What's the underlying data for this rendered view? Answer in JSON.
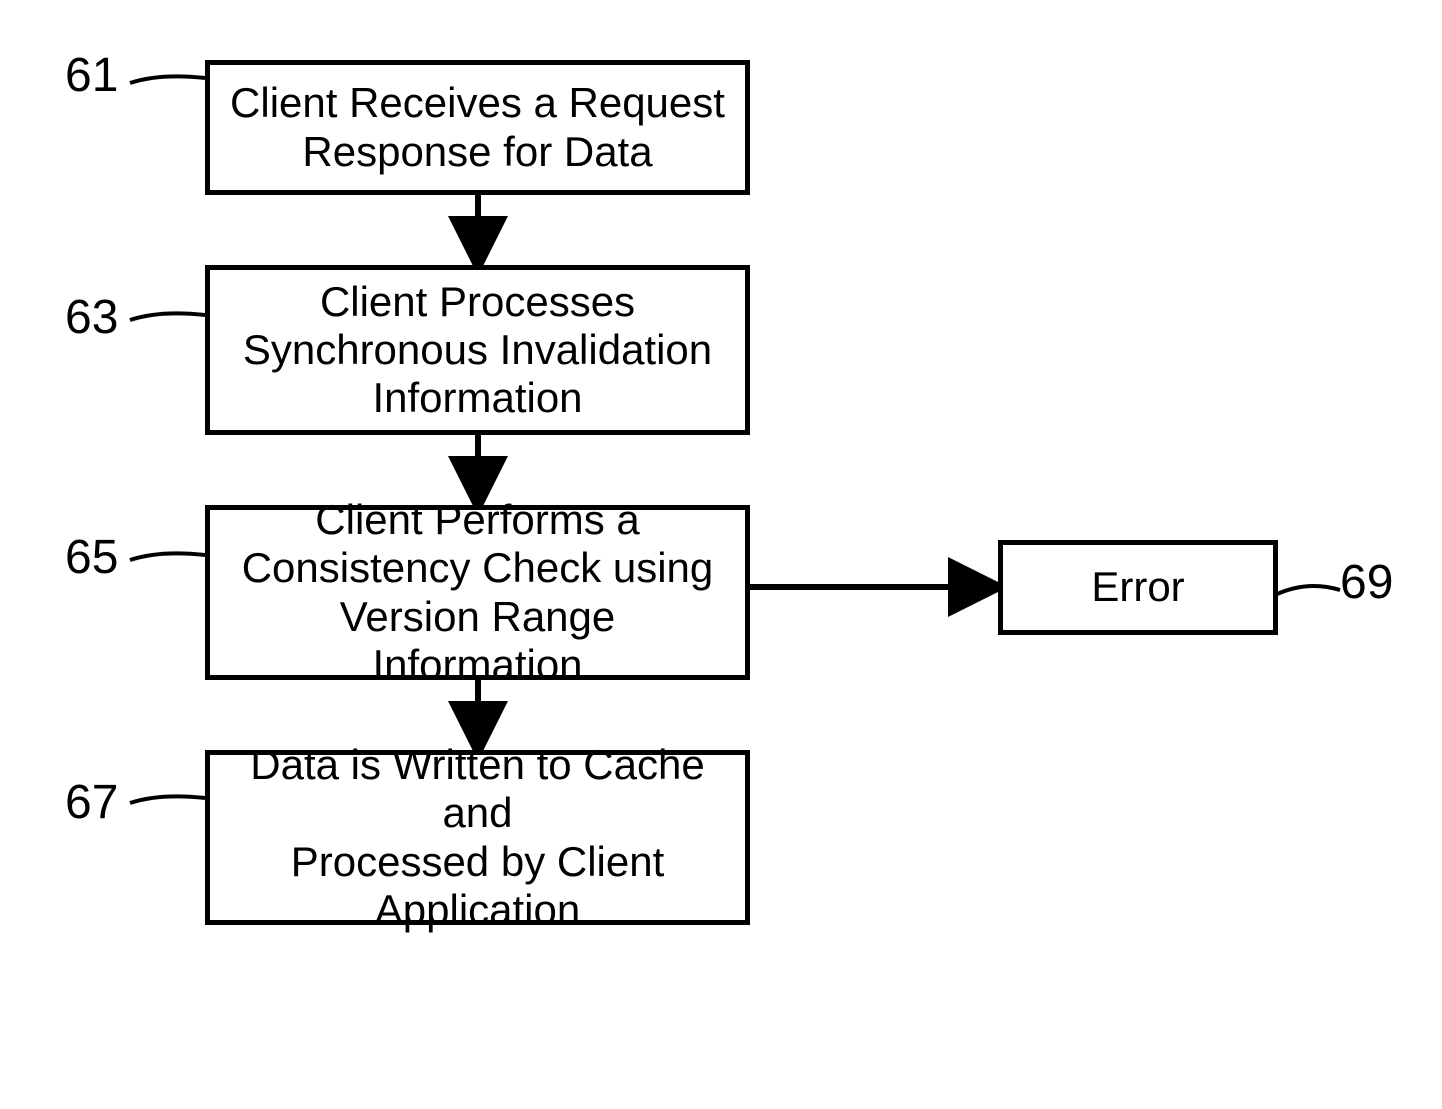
{
  "boxes": {
    "b61": "Client Receives a Request\nResponse for Data",
    "b63": "Client Processes\nSynchronous Invalidation\nInformation",
    "b65": "Client Performs a\nConsistency Check using\nVersion Range Information",
    "b67": "Data is Written to Cache and\nProcessed by Client\nApplication",
    "b69": "Error"
  },
  "labels": {
    "l61": "61",
    "l63": "63",
    "l65": "65",
    "l67": "67",
    "l69": "69"
  }
}
